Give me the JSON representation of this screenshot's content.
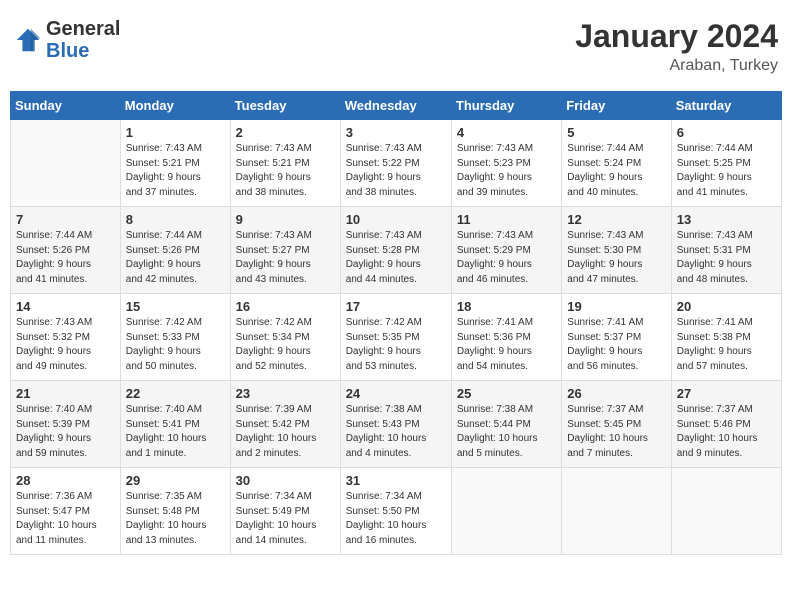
{
  "header": {
    "logo_general": "General",
    "logo_blue": "Blue",
    "month": "January 2024",
    "location": "Araban, Turkey"
  },
  "weekdays": [
    "Sunday",
    "Monday",
    "Tuesday",
    "Wednesday",
    "Thursday",
    "Friday",
    "Saturday"
  ],
  "weeks": [
    [
      {
        "day": "",
        "info": ""
      },
      {
        "day": "1",
        "info": "Sunrise: 7:43 AM\nSunset: 5:21 PM\nDaylight: 9 hours\nand 37 minutes."
      },
      {
        "day": "2",
        "info": "Sunrise: 7:43 AM\nSunset: 5:21 PM\nDaylight: 9 hours\nand 38 minutes."
      },
      {
        "day": "3",
        "info": "Sunrise: 7:43 AM\nSunset: 5:22 PM\nDaylight: 9 hours\nand 38 minutes."
      },
      {
        "day": "4",
        "info": "Sunrise: 7:43 AM\nSunset: 5:23 PM\nDaylight: 9 hours\nand 39 minutes."
      },
      {
        "day": "5",
        "info": "Sunrise: 7:44 AM\nSunset: 5:24 PM\nDaylight: 9 hours\nand 40 minutes."
      },
      {
        "day": "6",
        "info": "Sunrise: 7:44 AM\nSunset: 5:25 PM\nDaylight: 9 hours\nand 41 minutes."
      }
    ],
    [
      {
        "day": "7",
        "info": "Sunrise: 7:44 AM\nSunset: 5:26 PM\nDaylight: 9 hours\nand 41 minutes."
      },
      {
        "day": "8",
        "info": "Sunrise: 7:44 AM\nSunset: 5:26 PM\nDaylight: 9 hours\nand 42 minutes."
      },
      {
        "day": "9",
        "info": "Sunrise: 7:43 AM\nSunset: 5:27 PM\nDaylight: 9 hours\nand 43 minutes."
      },
      {
        "day": "10",
        "info": "Sunrise: 7:43 AM\nSunset: 5:28 PM\nDaylight: 9 hours\nand 44 minutes."
      },
      {
        "day": "11",
        "info": "Sunrise: 7:43 AM\nSunset: 5:29 PM\nDaylight: 9 hours\nand 46 minutes."
      },
      {
        "day": "12",
        "info": "Sunrise: 7:43 AM\nSunset: 5:30 PM\nDaylight: 9 hours\nand 47 minutes."
      },
      {
        "day": "13",
        "info": "Sunrise: 7:43 AM\nSunset: 5:31 PM\nDaylight: 9 hours\nand 48 minutes."
      }
    ],
    [
      {
        "day": "14",
        "info": "Sunrise: 7:43 AM\nSunset: 5:32 PM\nDaylight: 9 hours\nand 49 minutes."
      },
      {
        "day": "15",
        "info": "Sunrise: 7:42 AM\nSunset: 5:33 PM\nDaylight: 9 hours\nand 50 minutes."
      },
      {
        "day": "16",
        "info": "Sunrise: 7:42 AM\nSunset: 5:34 PM\nDaylight: 9 hours\nand 52 minutes."
      },
      {
        "day": "17",
        "info": "Sunrise: 7:42 AM\nSunset: 5:35 PM\nDaylight: 9 hours\nand 53 minutes."
      },
      {
        "day": "18",
        "info": "Sunrise: 7:41 AM\nSunset: 5:36 PM\nDaylight: 9 hours\nand 54 minutes."
      },
      {
        "day": "19",
        "info": "Sunrise: 7:41 AM\nSunset: 5:37 PM\nDaylight: 9 hours\nand 56 minutes."
      },
      {
        "day": "20",
        "info": "Sunrise: 7:41 AM\nSunset: 5:38 PM\nDaylight: 9 hours\nand 57 minutes."
      }
    ],
    [
      {
        "day": "21",
        "info": "Sunrise: 7:40 AM\nSunset: 5:39 PM\nDaylight: 9 hours\nand 59 minutes."
      },
      {
        "day": "22",
        "info": "Sunrise: 7:40 AM\nSunset: 5:41 PM\nDaylight: 10 hours\nand 1 minute."
      },
      {
        "day": "23",
        "info": "Sunrise: 7:39 AM\nSunset: 5:42 PM\nDaylight: 10 hours\nand 2 minutes."
      },
      {
        "day": "24",
        "info": "Sunrise: 7:38 AM\nSunset: 5:43 PM\nDaylight: 10 hours\nand 4 minutes."
      },
      {
        "day": "25",
        "info": "Sunrise: 7:38 AM\nSunset: 5:44 PM\nDaylight: 10 hours\nand 5 minutes."
      },
      {
        "day": "26",
        "info": "Sunrise: 7:37 AM\nSunset: 5:45 PM\nDaylight: 10 hours\nand 7 minutes."
      },
      {
        "day": "27",
        "info": "Sunrise: 7:37 AM\nSunset: 5:46 PM\nDaylight: 10 hours\nand 9 minutes."
      }
    ],
    [
      {
        "day": "28",
        "info": "Sunrise: 7:36 AM\nSunset: 5:47 PM\nDaylight: 10 hours\nand 11 minutes."
      },
      {
        "day": "29",
        "info": "Sunrise: 7:35 AM\nSunset: 5:48 PM\nDaylight: 10 hours\nand 13 minutes."
      },
      {
        "day": "30",
        "info": "Sunrise: 7:34 AM\nSunset: 5:49 PM\nDaylight: 10 hours\nand 14 minutes."
      },
      {
        "day": "31",
        "info": "Sunrise: 7:34 AM\nSunset: 5:50 PM\nDaylight: 10 hours\nand 16 minutes."
      },
      {
        "day": "",
        "info": ""
      },
      {
        "day": "",
        "info": ""
      },
      {
        "day": "",
        "info": ""
      }
    ]
  ]
}
